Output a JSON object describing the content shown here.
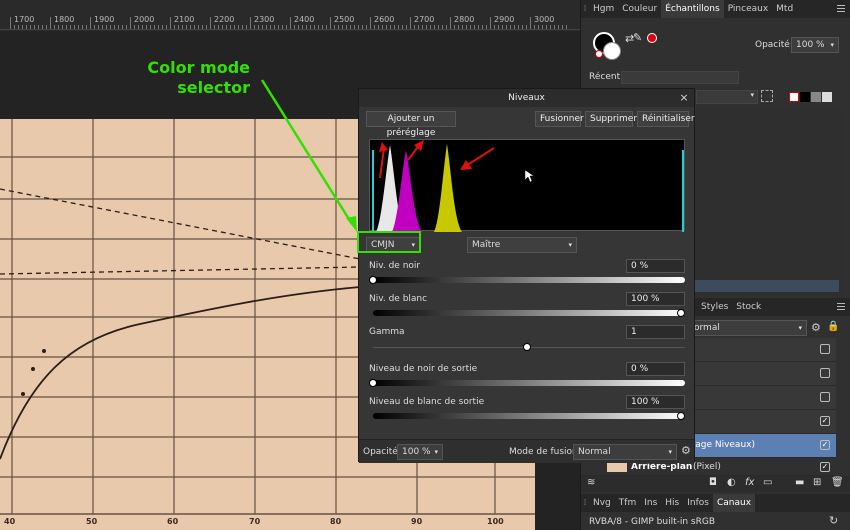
{
  "ruler": {
    "labels": [
      "1700",
      "1800",
      "1900",
      "2000",
      "2100",
      "2200",
      "2300",
      "2400",
      "2500",
      "2600",
      "2700",
      "2800",
      "2900",
      "3000"
    ]
  },
  "annotation": {
    "line1": "Color mode",
    "line2": "selector"
  },
  "chart_axis": {
    "labels": [
      "40",
      "50",
      "60",
      "70",
      "80",
      "90",
      "100"
    ]
  },
  "right_panel": {
    "tabs": [
      "Hgm",
      "Couleur",
      "Échantillons",
      "Pinceaux",
      "Mtd"
    ],
    "active_tab": "Échantillons",
    "opacity_label": "Opacité:",
    "opacity_value": "100 %",
    "recent_label": "Récent:",
    "layers_tabs": [
      "Styles",
      "Stock"
    ],
    "blend_value": "ormal",
    "layer_selected_label": "glage Niveaux)",
    "layer_bg_label": "Arrière-plan",
    "layer_bg_type": "(Pixel)",
    "bottom_tabs": [
      "Nvg",
      "Tfm",
      "Ins",
      "His",
      "Infos",
      "Canaux"
    ],
    "bottom_active": "Canaux",
    "status": "RVBA/8 - GIMP built-in sRGB"
  },
  "dialog": {
    "title": "Niveaux",
    "add_preset": "Ajouter un préréglage",
    "merge": "Fusionner",
    "delete": "Supprimer",
    "reset": "Réinitialiser",
    "mode_value": "CMJN",
    "channel_value": "Maître",
    "black_level_label": "Niv. de noir",
    "black_level_value": "0 %",
    "black_level_fraction": 0,
    "white_level_label": "Niv. de blanc",
    "white_level_value": "100 %",
    "white_level_fraction": 1,
    "gamma_label": "Gamma",
    "gamma_value": "1",
    "gamma_fraction": 0.5,
    "out_black_label": "Niveau de noir de sortie",
    "out_black_value": "0 %",
    "out_black_fraction": 0,
    "out_white_label": "Niveau de blanc de sortie",
    "out_white_value": "100 %",
    "out_white_fraction": 1,
    "opacity_label": "Opacité:",
    "opacity_value": "100 %",
    "blend_label": "Mode de fusion:",
    "blend_value": "Normal"
  },
  "colors": {
    "annotation": "#34e000",
    "selection": "#5c80b3",
    "paper": "#e8c9ab"
  }
}
